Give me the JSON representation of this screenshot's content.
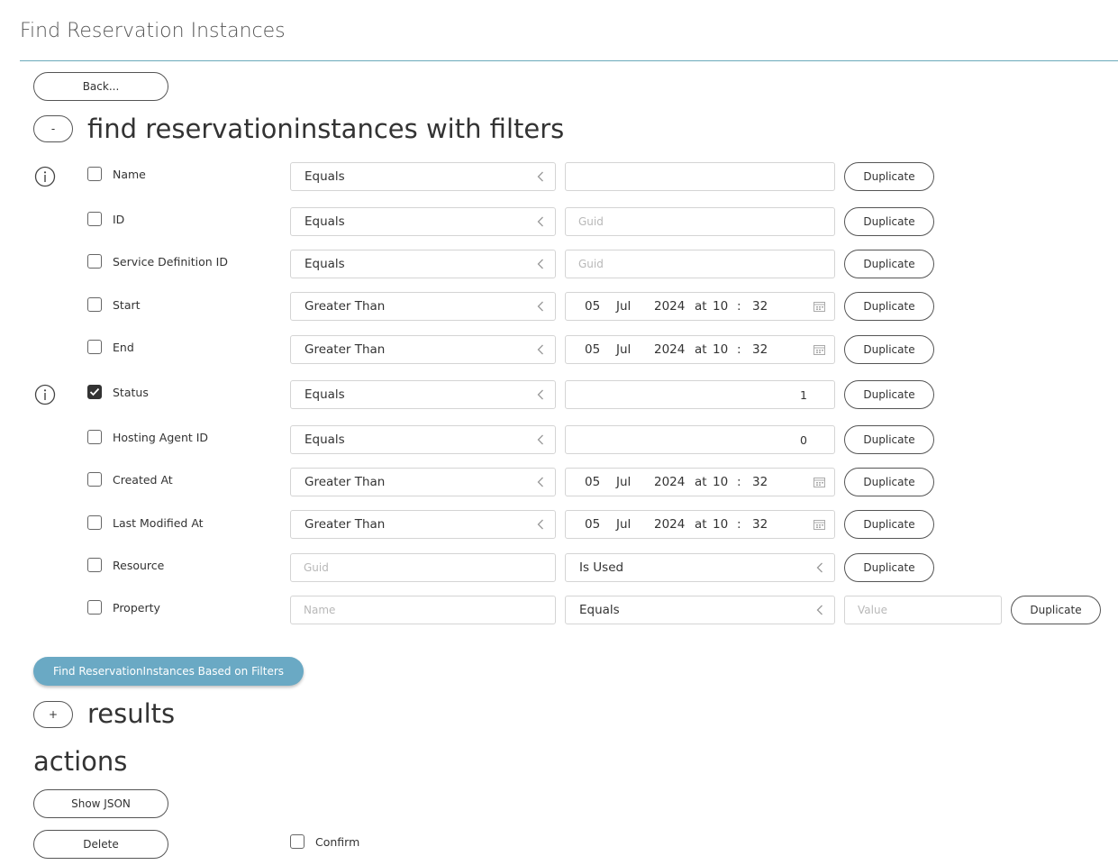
{
  "page": {
    "title": "Find Reservation Instances"
  },
  "back_label": "Back...",
  "filters_section": {
    "toggle_label": "-",
    "heading": "find reservationinstances with filters"
  },
  "duplicate_label": "Duplicate",
  "rows": [
    {
      "label": "Name",
      "checked": false,
      "operator": "Equals",
      "value": "",
      "placeholder": ""
    },
    {
      "label": "ID",
      "checked": false,
      "operator": "Equals",
      "value": "",
      "placeholder": "Guid"
    },
    {
      "label": "Service Definition ID",
      "checked": false,
      "operator": "Equals",
      "value": "",
      "placeholder": "Guid"
    },
    {
      "label": "Start",
      "checked": false,
      "operator": "Greater Than",
      "date": {
        "day": "05",
        "month": "Jul",
        "year": "2024",
        "at": "at",
        "hour": "10",
        "sep": ":",
        "minute": "32"
      }
    },
    {
      "label": "End",
      "checked": false,
      "operator": "Greater Than",
      "date": {
        "day": "05",
        "month": "Jul",
        "year": "2024",
        "at": "at",
        "hour": "10",
        "sep": ":",
        "minute": "32"
      }
    },
    {
      "label": "Status",
      "checked": true,
      "operator": "Equals",
      "value": "1"
    },
    {
      "label": "Hosting Agent ID",
      "checked": false,
      "operator": "Equals",
      "value": "0"
    },
    {
      "label": "Created At",
      "checked": false,
      "operator": "Greater Than",
      "date": {
        "day": "05",
        "month": "Jul",
        "year": "2024",
        "at": "at",
        "hour": "10",
        "sep": ":",
        "minute": "32"
      }
    },
    {
      "label": "Last Modified At",
      "checked": false,
      "operator": "Greater Than",
      "date": {
        "day": "05",
        "month": "Jul",
        "year": "2024",
        "at": "at",
        "hour": "10",
        "sep": ":",
        "minute": "32"
      }
    },
    {
      "label": "Resource",
      "checked": false,
      "guid_placeholder": "Guid",
      "operator": "Is Used"
    },
    {
      "label": "Property",
      "checked": false,
      "name_placeholder": "Name",
      "operator": "Equals",
      "value_placeholder": "Value"
    }
  ],
  "find_button_label": "Find ReservationInstances Based on Filters",
  "results_section": {
    "toggle_label": "+",
    "heading": "results"
  },
  "actions": {
    "heading": "actions",
    "show_json_label": "Show JSON",
    "delete_label": "Delete",
    "confirm_label": "Confirm",
    "confirm_checked": false
  },
  "colors": {
    "accent": "#6aa9c4",
    "rule": "#6aa9ba",
    "checkbox_checked": "#333333"
  },
  "icons": {
    "info": "info-circle-icon",
    "dropdown": "chevron-left-icon",
    "calendar": "calendar-icon",
    "check": "check-icon"
  }
}
